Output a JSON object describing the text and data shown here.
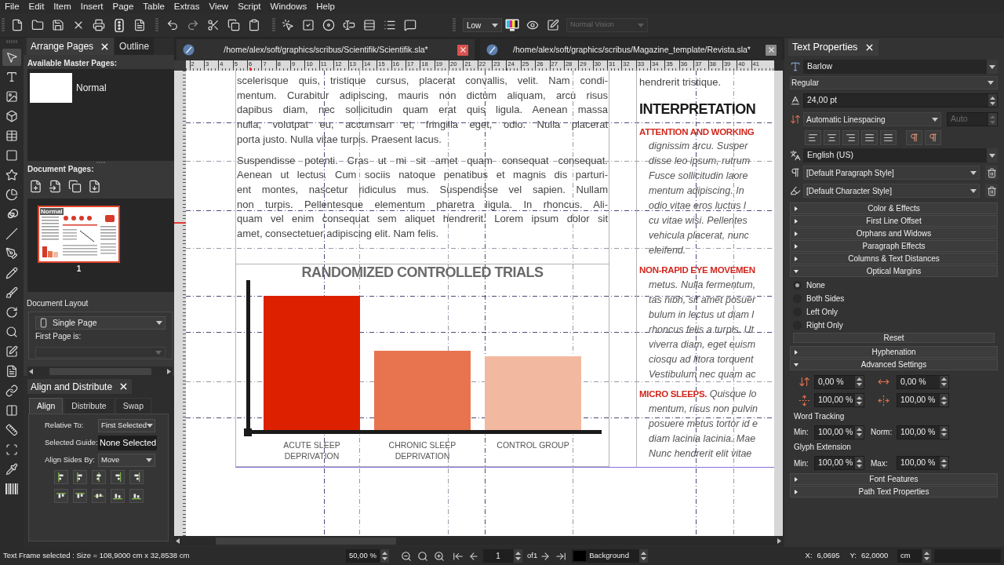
{
  "menu": [
    "File",
    "Edit",
    "Item",
    "Insert",
    "Page",
    "Table",
    "Extras",
    "View",
    "Script",
    "Windows",
    "Help"
  ],
  "toolbar": {
    "quality": "Low",
    "vision": {
      "label": "Normal Vision",
      "disabled": true
    }
  },
  "tools": [
    {
      "selected": true
    },
    {
      "selected": false
    },
    {
      "selected": false
    },
    {
      "selected": false
    },
    {
      "selected": false
    },
    {
      "selected": false
    },
    {
      "selected": false
    },
    {
      "selected": false
    },
    {
      "selected": false
    },
    {
      "selected": false
    },
    {
      "selected": false
    },
    {
      "selected": false
    },
    {
      "selected": false
    },
    {
      "selected": false
    },
    {
      "selected": false
    },
    {
      "selected": false
    },
    {
      "selected": false
    },
    {
      "selected": false
    },
    {
      "selected": false
    },
    {
      "selected": false
    },
    {
      "selected": false
    },
    {
      "selected": false
    },
    {
      "selected": false
    }
  ],
  "left_dock": {
    "tabs": [
      {
        "label": "Arrange Pages",
        "selected": true
      },
      {
        "label": "Outline",
        "selected": false
      }
    ],
    "master_pages_label": "Available Master Pages:",
    "master_pages": [
      {
        "name": "Normal"
      }
    ],
    "document_pages_label": "Document Pages:",
    "pages": [
      {
        "master": "Normal",
        "number": "1",
        "selected": true
      }
    ],
    "layout_label": "Document Layout",
    "layout": "Single Page",
    "first_page_label": "First Page is:"
  },
  "align_panel": {
    "title": "Align and Distribute",
    "tabs": [
      {
        "label": "Align",
        "selected": true
      },
      {
        "label": "Distribute",
        "selected": false
      },
      {
        "label": "Swap",
        "selected": false
      }
    ],
    "rows": [
      {
        "kind": "combo",
        "label": "Relative To:",
        "value": "First Selected"
      },
      {
        "kind": "display",
        "label": "Selected Guide:",
        "value": "None Selected"
      },
      {
        "kind": "combo",
        "label": "Align Sides By:",
        "value": "Move"
      }
    ]
  },
  "documents": [
    {
      "path": "/home/alex/soft/graphics/scribus/Scientifik/Scientifik.sla*",
      "selected": true
    },
    {
      "path": "/home/alex/soft/graphics/scribus/Magazine_template/Revista.sla*",
      "selected": false
    }
  ],
  "ruler": {
    "labels": [
      "2",
      "3",
      "4",
      "5",
      "6",
      "7",
      "8",
      "9",
      "10",
      "11",
      "12",
      "13",
      "14",
      "15",
      "16",
      "17",
      "18",
      "19",
      "20",
      "21",
      "22",
      "23",
      "24",
      "25",
      "26",
      "27",
      "28",
      "29",
      "30",
      "31",
      "32",
      "33",
      "34",
      "35",
      "36",
      "37",
      "38",
      "39",
      "40",
      "41"
    ]
  },
  "page": {
    "paragraphs": [
      "scelerisque quis, tristique cursus, placerat convallis, velit. Nam condi-\nmentum. Curabitur adipiscing, mauris non dictum aliquam, arcu risus\ndapibus diam, nec sollicitudin quam erat quis ligula. Aenean massa\nnulla, volutpat eu, accumsan et, fringilla eget, odio. Nulla placerat\nporta justo. Nulla vitae turpis. Praesent lacus.",
      "Suspendisse potenti. Cras ut mi sit amet quam consequat consequat.\nAenean ut lectus. Cum sociis natoque penatibus et magnis dis parturi-\nent montes, nascetur ridiculus mus. Suspendisse vel sapien. Nullam\nnon turpis. Pellentesque elementum pharetra ligula. In rhoncus. Ali-\nquam vel enim consequat sem aliquet hendrerit. Lorem ipsum dolor sit\namet, consectetuer adipiscing elit. Nam felis."
    ],
    "chart": {
      "title": "RANDOMIZED CONTROLLED TRIALS",
      "labels": [
        "ACUTE SLEEP\nDEPRIVATION",
        "CHRONIC SLEEP\nDEPRIVATION",
        "CONTROL GROUP"
      ]
    },
    "column": [
      {
        "kind": "body",
        "lines": [
          "hendrerit tristique."
        ]
      },
      {
        "kind": "heading",
        "lines": [
          "INTERPRETATION"
        ]
      },
      {
        "kind": "section",
        "lines": [
          "**ATTENTION AND WORKING**",
          "dignissim arcu. Susper",
          "disse leo ipsum, rutrum",
          "Fusce sollicitudin laore",
          "mentum adipiscing. In",
          "odio vitae eros luctus l",
          "cu vitae wisi. Pellentes",
          "vehicula placerat, nunc",
          "eleifend."
        ]
      },
      {
        "kind": "section",
        "lines": [
          "**NON-RAPID EYE MOVEMEN**",
          "metus. Nulla fermentum,",
          "tas nibh, sit amet posuer",
          "bulum in lectus ut diam l",
          "rhoncus felis a turpis. Ut",
          "viverra diam, eget euism",
          "ciosqu ad litora torquent",
          "Vestibulum nec quam ac"
        ]
      },
      {
        "kind": "section",
        "lines": [
          "**MICRO SLEEPS.** Quisque lo",
          "mentum, risus non pulvin",
          "posuere metus tortor id e",
          "diam lacinia lacinia. Mae",
          "Nunc hendrerit elit vitae"
        ]
      }
    ]
  },
  "text_properties": {
    "title": "Text Properties",
    "font": "Barlow",
    "style": "Regular",
    "size": "24,00 pt",
    "linespacing": "Automatic Linespacing",
    "linespacing_value": {
      "text": "Auto",
      "disabled": true
    },
    "language": "English (US)",
    "paragraph_style": "[Default Paragraph Style]",
    "character_style": "[Default Character Style]",
    "sections": [
      {
        "label": "Color & Effects",
        "expanded": false
      },
      {
        "label": "First Line Offset",
        "expanded": false
      },
      {
        "label": "Orphans and Widows",
        "expanded": false
      },
      {
        "label": "Paragraph Effects",
        "expanded": false
      },
      {
        "label": "Columns & Text Distances",
        "expanded": false
      },
      {
        "label": "Optical Margins",
        "expanded": true,
        "options": [
          {
            "label": "None",
            "selected": true
          },
          {
            "label": "Both Sides",
            "selected": false
          },
          {
            "label": "Left Only",
            "selected": false
          },
          {
            "label": "Right Only",
            "selected": false
          }
        ],
        "button": "Reset"
      },
      {
        "label": "Hyphenation",
        "expanded": false
      },
      {
        "label": "Advanced Settings",
        "expanded": true,
        "scales": [
          {
            "value": "0,00 %"
          },
          {
            "value": "0,00 %"
          },
          {
            "value": "100,00 %"
          },
          {
            "value": "100,00 %"
          }
        ],
        "groups": [
          {
            "title": "Word Tracking",
            "fields": [
              {
                "label": "Min:",
                "value": "100,00 %"
              },
              {
                "label": "Norm:",
                "value": "100,00 %"
              }
            ]
          },
          {
            "title": "Glyph Extension",
            "fields": [
              {
                "label": "Min:",
                "value": "100,00 %"
              },
              {
                "label": "Max:",
                "value": "100,00 %"
              }
            ]
          }
        ]
      },
      {
        "label": "Font Features",
        "expanded": false
      },
      {
        "label": "Path Text Properties",
        "expanded": false
      }
    ]
  },
  "status_bar": {
    "message": "Text Frame selected : Size = 108,9000 cm x 32,8538 cm",
    "zoom": "50,00 %",
    "page": "1",
    "page_count": "of1",
    "layer": "Background",
    "x_label": "X:",
    "x_value": "6,0695",
    "y_label": "Y:",
    "y_value": "62,0000",
    "unit": "cm"
  }
}
